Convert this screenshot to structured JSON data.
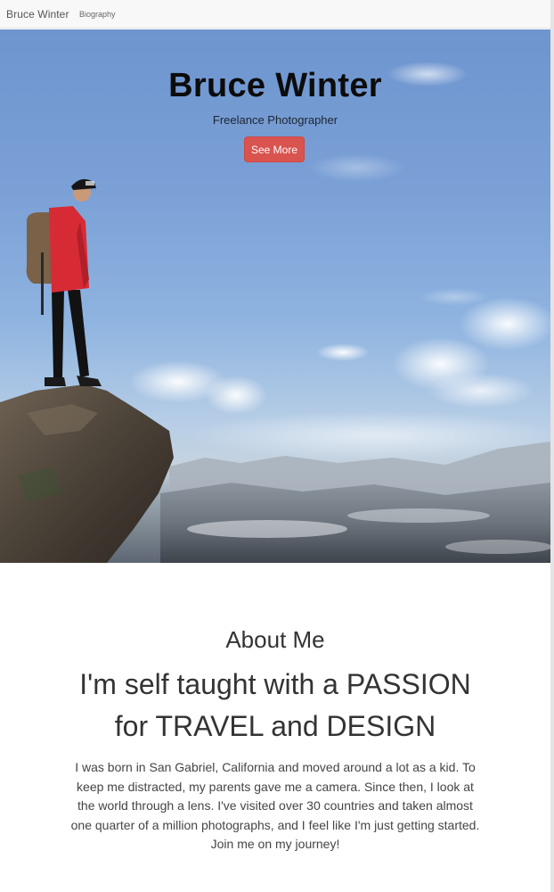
{
  "navbar": {
    "brand": "Bruce Winter",
    "links": [
      "Biography"
    ]
  },
  "hero": {
    "title": "Bruce Winter",
    "subtitle": "Freelance Photographer",
    "button_label": "See More",
    "image": "hiker-on-cliff-above-clouds-photo"
  },
  "about": {
    "heading": "About Me",
    "tagline_line1": "I'm self taught with a PASSION",
    "tagline_line2": "for TRAVEL and DESIGN",
    "body": "I was born in San Gabriel, California and moved around a lot as a kid. To keep me distracted, my parents gave me a camera. Since then, I look at the world through a lens. I've visited over 30 countries and taken almost one quarter of a million photographs, and I feel like I'm just getting started. Join me on my journey!"
  },
  "colors": {
    "button": "#d9534f",
    "navbar_bg": "#f8f8f8",
    "sky": "#7aa0d6"
  }
}
